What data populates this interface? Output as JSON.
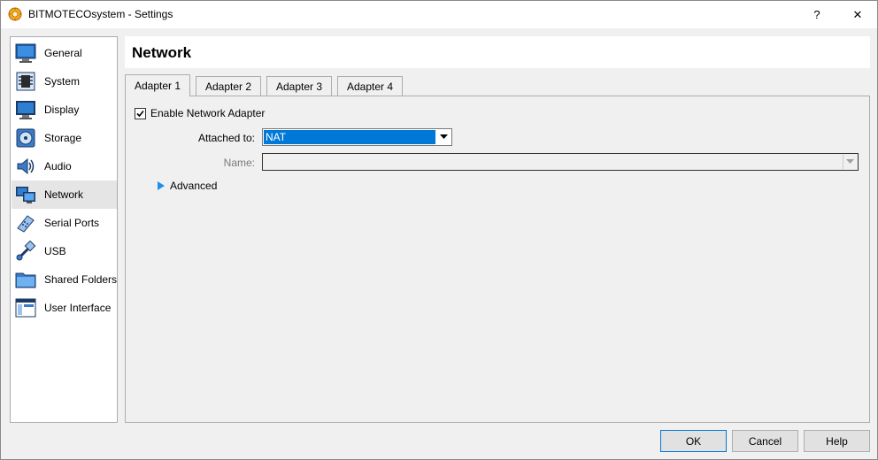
{
  "window": {
    "title": "BITMOTECOsystem - Settings",
    "help_glyph": "?",
    "close_glyph": "✕",
    "icon": "virtualbox-gear-icon"
  },
  "sidebar": {
    "items": [
      {
        "label": "General",
        "icon": "general-monitor-icon"
      },
      {
        "label": "System",
        "icon": "system-chip-icon"
      },
      {
        "label": "Display",
        "icon": "display-monitor-icon"
      },
      {
        "label": "Storage",
        "icon": "storage-disk-icon"
      },
      {
        "label": "Audio",
        "icon": "audio-speaker-icon"
      },
      {
        "label": "Network",
        "icon": "network-icon"
      },
      {
        "label": "Serial Ports",
        "icon": "serial-port-icon"
      },
      {
        "label": "USB",
        "icon": "usb-icon"
      },
      {
        "label": "Shared Folders",
        "icon": "folder-icon"
      },
      {
        "label": "User Interface",
        "icon": "window-ui-icon"
      }
    ],
    "selected_index": 5
  },
  "header": {
    "title": "Network"
  },
  "tabs": [
    {
      "label": "Adapter 1"
    },
    {
      "label": "Adapter 2"
    },
    {
      "label": "Adapter 3"
    },
    {
      "label": "Adapter 4"
    }
  ],
  "adapter": {
    "enable_label": "Enable Network Adapter",
    "enabled": true,
    "attached_label": "Attached to:",
    "attached_value": "NAT",
    "name_label": "Name:",
    "name_value": "",
    "advanced_label": "Advanced"
  },
  "buttons": {
    "ok": "OK",
    "cancel": "Cancel",
    "help": "Help"
  },
  "colors": {
    "accent": "#0078d7",
    "selected_item_bg": "#e5e5e5"
  }
}
